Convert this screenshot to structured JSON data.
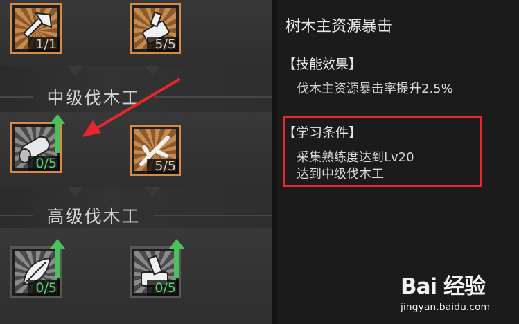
{
  "tiers": [
    {
      "title": ""
    },
    {
      "title": "中级伐木工"
    },
    {
      "title": "高级伐木工"
    }
  ],
  "skills": [
    {
      "id": "axe",
      "icon": "axe-icon",
      "count": "1/1",
      "count_color": "#cfcfcf",
      "frame": "orange",
      "upgrade": false
    },
    {
      "id": "log-chop",
      "icon": "wood-chop-icon",
      "count": "5/5",
      "count_color": "#cfcfcf",
      "frame": "orange",
      "upgrade": false
    },
    {
      "id": "log-crit",
      "icon": "log-icon",
      "count": "0/5",
      "count_color": "#57d16a",
      "frame": "orange",
      "upgrade": true,
      "selected": true
    },
    {
      "id": "branch",
      "icon": "branch-icon",
      "count": "5/5",
      "count_color": "#cfcfcf",
      "frame": "orange",
      "upgrade": false
    },
    {
      "id": "leaf",
      "icon": "leaf-icon",
      "count": "0/5",
      "count_color": "#57d16a",
      "frame": "gray",
      "upgrade": true
    },
    {
      "id": "stump",
      "icon": "stump-icon",
      "count": "0/5",
      "count_color": "#57d16a",
      "frame": "gray",
      "upgrade": true
    }
  ],
  "detail": {
    "name": "树木主资源暴击",
    "effect_title": "【技能效果】",
    "effect_text": "伐木主资源暴击率提升2.5%",
    "req_title": "【学习条件】",
    "req_lines": [
      "采集熟练度达到Lv20",
      "达到中级伐木工"
    ]
  },
  "annotations": {
    "arrow_color": "#e6272b",
    "box_color": "#e6272b"
  },
  "watermark": {
    "logo": "Bai 经验",
    "url": "jingyan.baidu.com"
  },
  "colors": {
    "accent_orange": "#d68a45",
    "progress_green": "#57d16a"
  }
}
